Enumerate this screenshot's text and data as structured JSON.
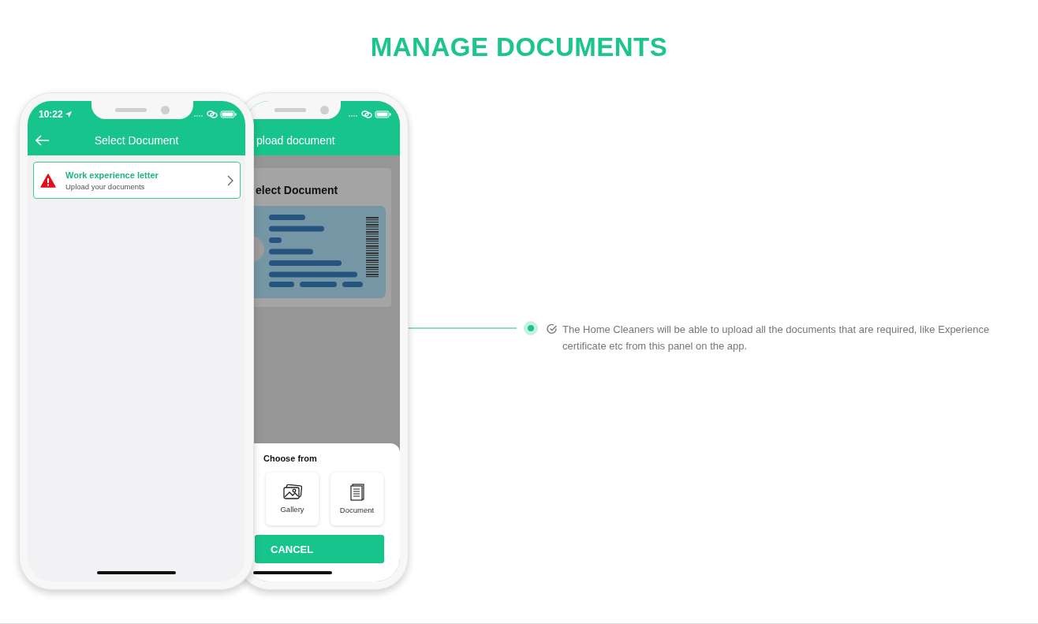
{
  "title": "MANAGE DOCUMENTS",
  "front_phone": {
    "time": "10:22",
    "header": "Select Document",
    "documents": [
      {
        "title": "Work experience letter",
        "subtitle": "Upload your documents"
      }
    ]
  },
  "back_phone": {
    "header": "pload document",
    "card_title": "elect Document",
    "sheet": {
      "title": "Choose from",
      "options": [
        {
          "kind": "gallery",
          "label": "Gallery"
        },
        {
          "kind": "document",
          "label": "Document"
        }
      ],
      "cancel": "CANCEL"
    }
  },
  "feature": {
    "text": "The Home Cleaners will be able to upload all the documents that are required, like Experience certificate etc from this panel on the app."
  }
}
